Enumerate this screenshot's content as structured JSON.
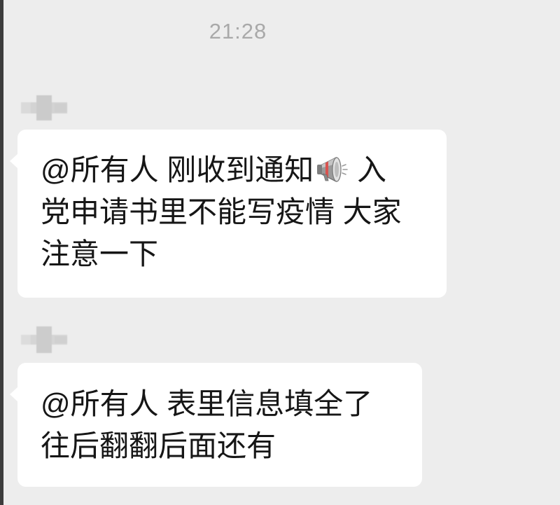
{
  "timestamp": "21:28",
  "colors": {
    "background": "#ededed",
    "bubble": "#ffffff",
    "timestamp": "#a9a9a9",
    "text": "#161616"
  },
  "messages": [
    {
      "lines": [
        {
          "text": "@所有人 刚收到通知",
          "icon": "megaphone-icon",
          "after": " 入"
        },
        {
          "text": "党申请书里不能写疫情 大家"
        },
        {
          "text": "注意一下"
        }
      ]
    },
    {
      "lines": [
        {
          "text": "@所有人 表里信息填全了"
        },
        {
          "text": "往后翻翻后面还有"
        }
      ]
    }
  ]
}
